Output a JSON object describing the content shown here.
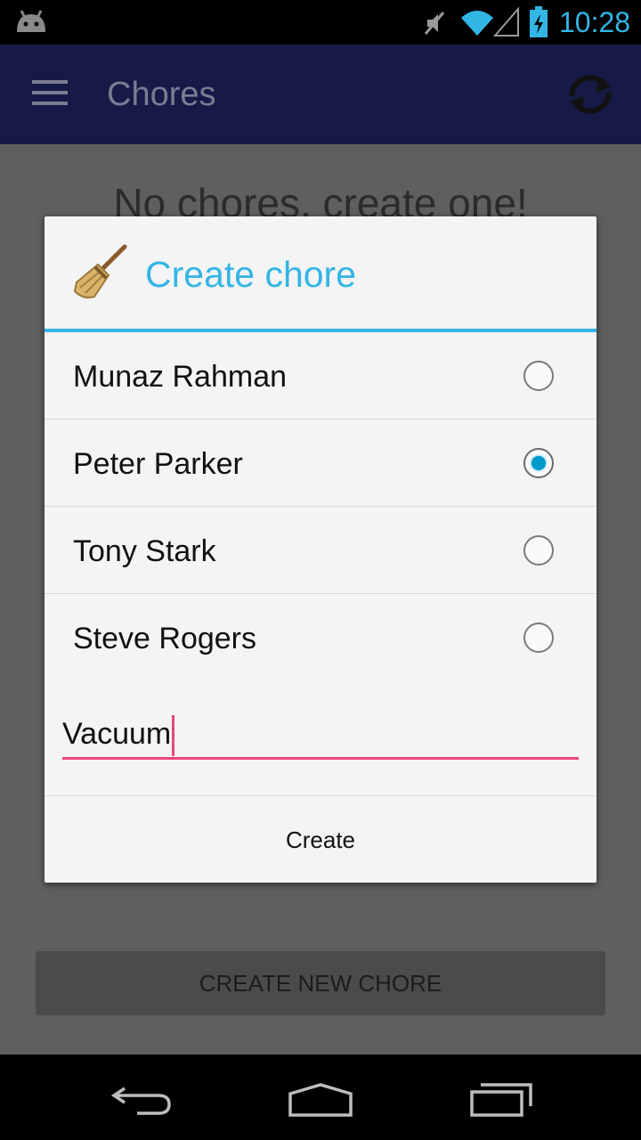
{
  "status_bar": {
    "time": "10:28",
    "icons": [
      "android-icon",
      "muted-icon",
      "wifi-icon",
      "signal-icon",
      "battery-charging-icon"
    ]
  },
  "action_bar": {
    "title": "Chores",
    "icons": [
      "menu-icon",
      "refresh-icon"
    ]
  },
  "content": {
    "empty_message": "No chores, create one!",
    "create_new_button": "CREATE NEW CHORE"
  },
  "dialog": {
    "title": "Create chore",
    "icon": "broom-icon",
    "people": [
      {
        "name": "Munaz Rahman",
        "selected": false
      },
      {
        "name": "Peter Parker",
        "selected": true
      },
      {
        "name": "Tony Stark",
        "selected": false
      },
      {
        "name": "Steve Rogers",
        "selected": false
      }
    ],
    "chore_input_value": "Vacuum",
    "create_button": "Create"
  },
  "nav_bar": {
    "icons": [
      "back-icon",
      "home-icon",
      "recents-icon"
    ]
  },
  "colors": {
    "accent": "#33b5e5",
    "input_underline": "#e9467f",
    "radio_selected": "#0099cc"
  }
}
